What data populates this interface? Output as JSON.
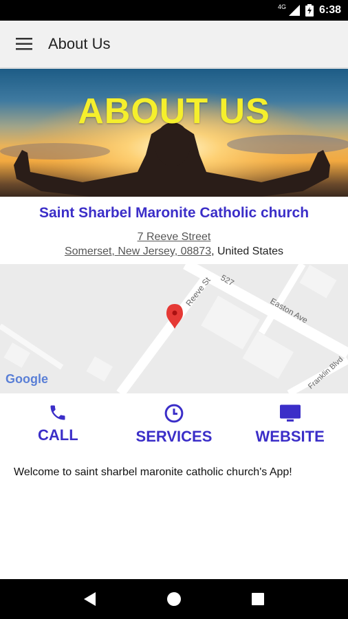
{
  "status_bar": {
    "network": "4G",
    "time": "6:38"
  },
  "app_bar": {
    "title": "About Us",
    "menu_icon": "hamburger-menu-icon"
  },
  "hero": {
    "title": "ABOUT US"
  },
  "church": {
    "name": "Saint Sharbel Maronite Catholic church",
    "street": "7 Reeve Street",
    "city_line": "Somerset, New Jersey, 08873",
    "country": ", United States"
  },
  "map": {
    "labels": {
      "road_527": "527",
      "reeve": "Reeve St",
      "easton": "Easton Ave",
      "franklin": "Franklin Blvd"
    },
    "attribution": "Google"
  },
  "actions": [
    {
      "label": "CALL",
      "icon": "phone-icon"
    },
    {
      "label": "SERVICES",
      "icon": "clock-icon"
    },
    {
      "label": "WEBSITE",
      "icon": "monitor-icon"
    }
  ],
  "welcome_text": "Welcome to saint sharbel maronite catholic church's App!",
  "colors": {
    "accent": "#3b2ec8",
    "hero_title": "#f5ef2c",
    "app_bar": "#f1f1f1"
  }
}
